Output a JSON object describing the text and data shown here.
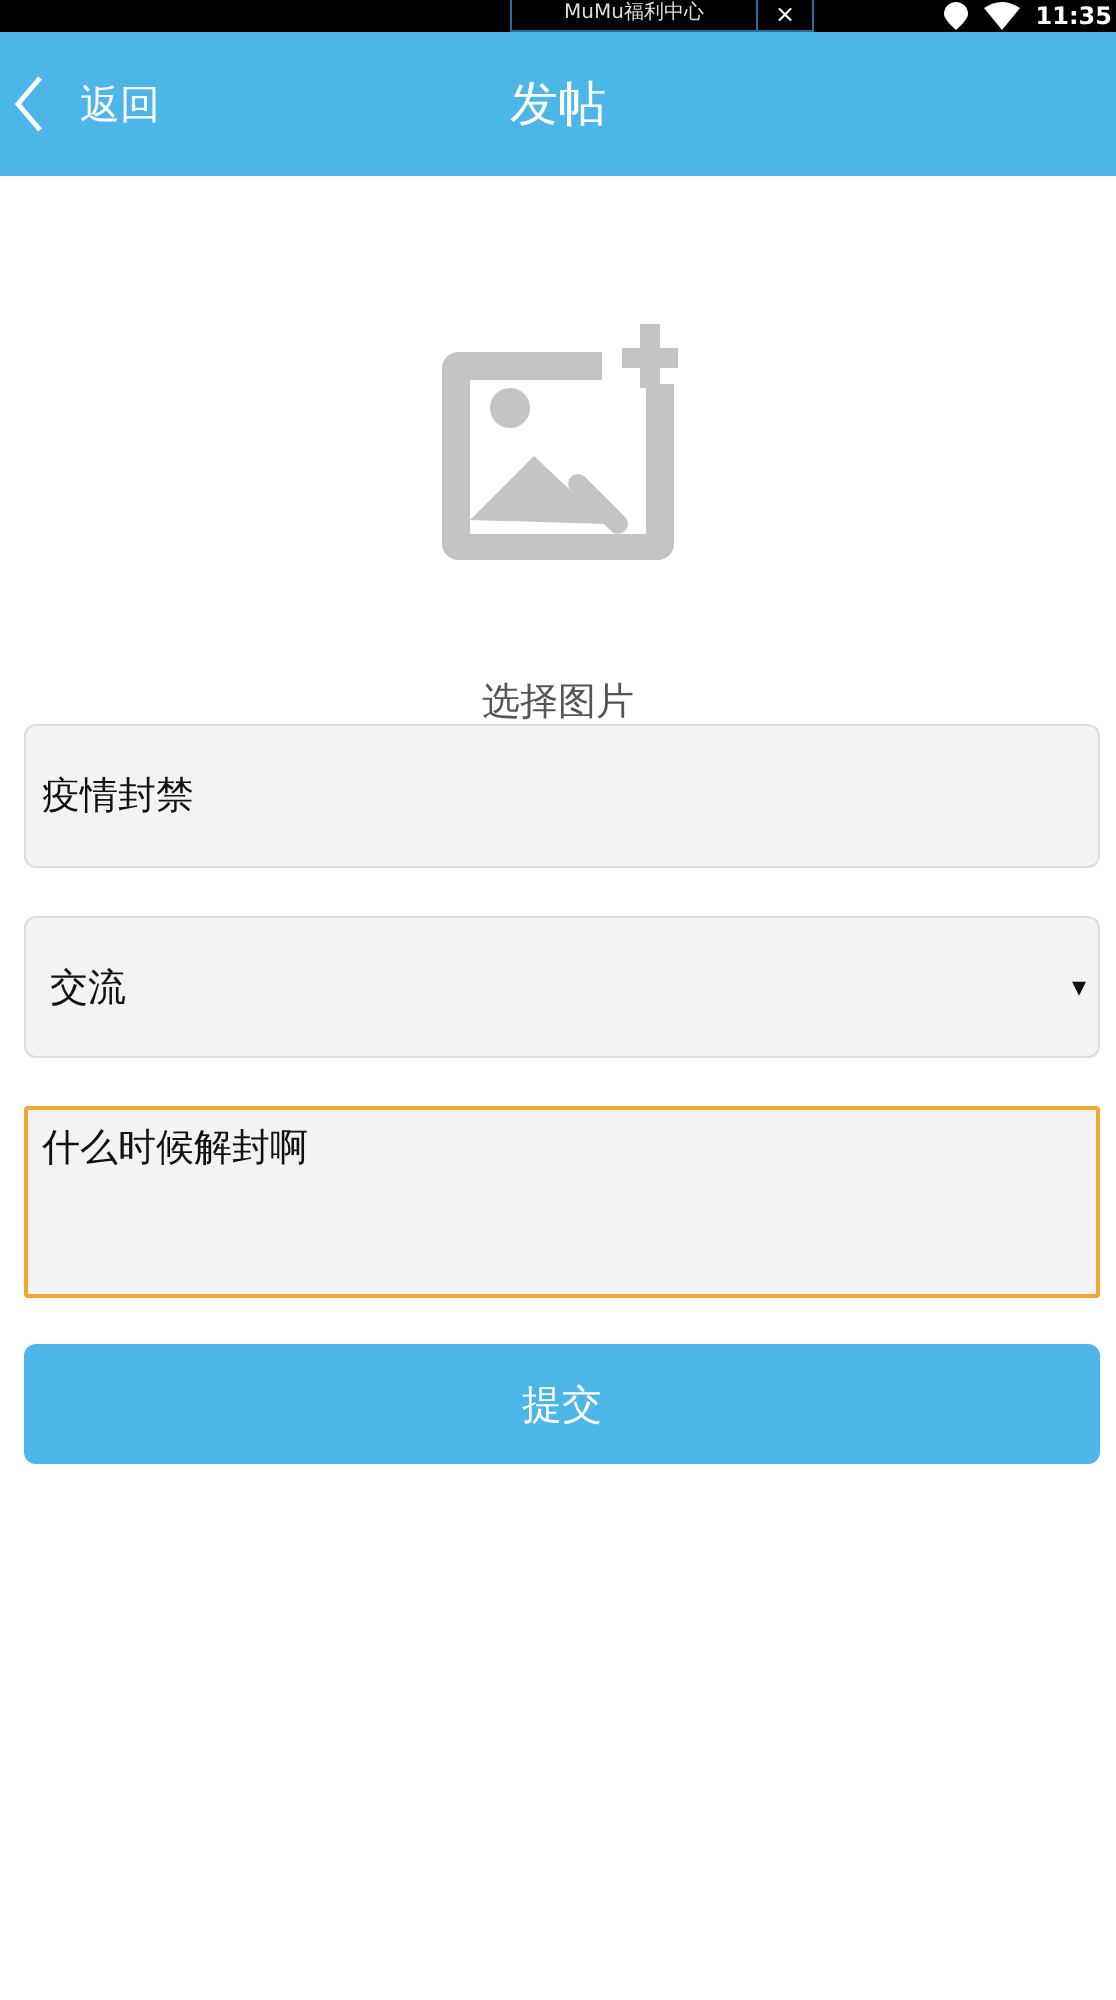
{
  "status_bar": {
    "notification": "MuMu福利中心",
    "close": "×",
    "time": "11:35"
  },
  "header": {
    "back": "返回",
    "title": "发帖"
  },
  "image_picker": {
    "label": "选择图片"
  },
  "title_field": {
    "value": "疫情封禁",
    "focused": false
  },
  "category_select": {
    "value": "交流",
    "caret": "▾",
    "focused": false
  },
  "content_field": {
    "value": "什么时候解封啊",
    "focused": true
  },
  "submit_button": {
    "label": "提交"
  }
}
